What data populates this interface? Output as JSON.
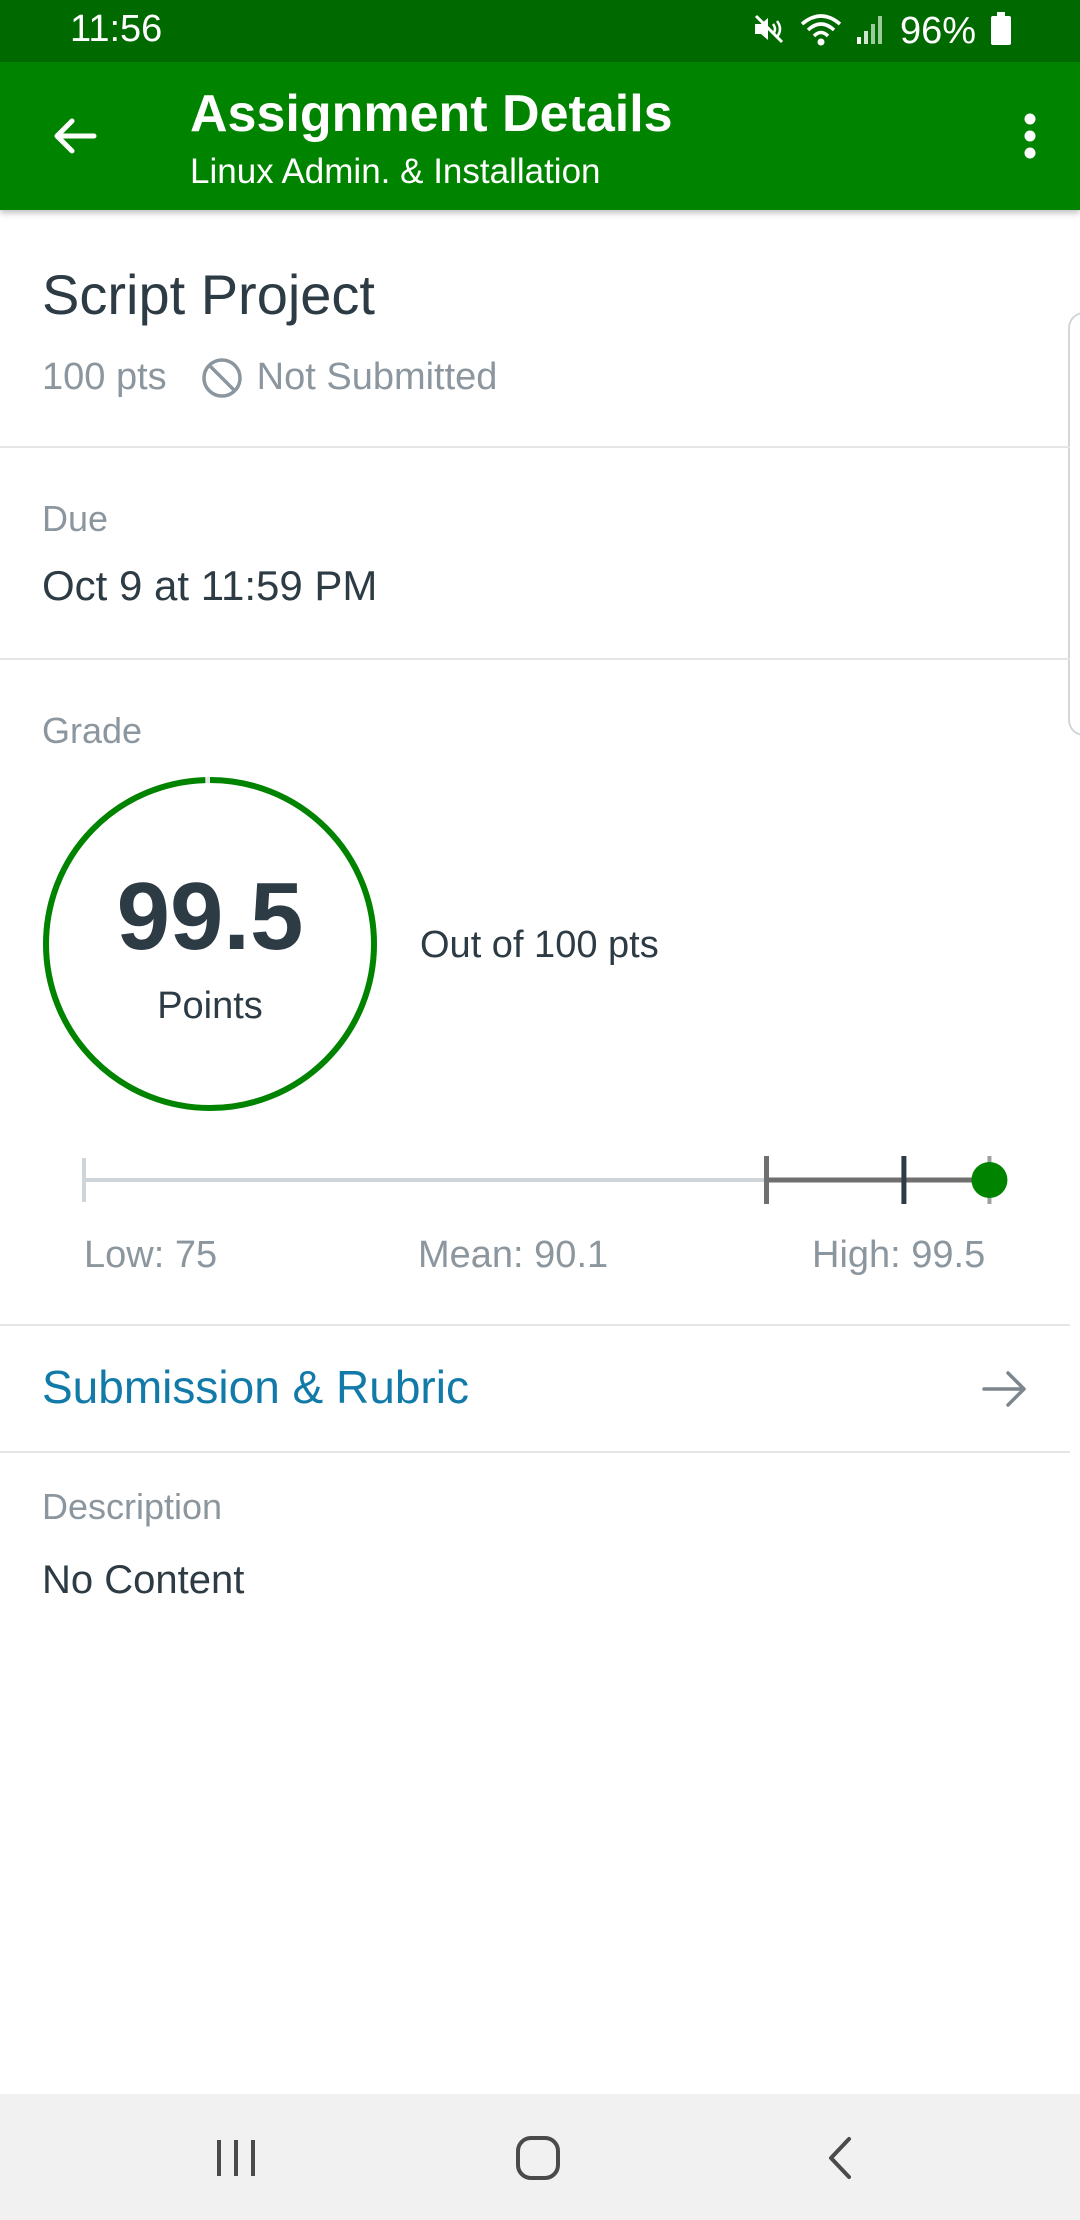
{
  "status_bar": {
    "time": "11:56",
    "battery_percent": "96%",
    "icons": [
      "mute-icon",
      "wifi-icon",
      "signal-icon",
      "battery-icon"
    ]
  },
  "app_bar": {
    "title": "Assignment Details",
    "subtitle": "Linux Admin. & Installation",
    "icons": [
      "back-arrow-icon",
      "more-vert-icon"
    ]
  },
  "assignment": {
    "title": "Script Project",
    "points": "100 pts",
    "submission_status": "Not Submitted",
    "status_icon": "not-submitted-icon"
  },
  "due": {
    "label": "Due",
    "value": "Oct 9 at 11:59 PM"
  },
  "grade": {
    "label": "Grade",
    "score": "99.5",
    "unit": "Points",
    "out_of": "Out of 100 pts",
    "score_value": 99.5,
    "max_points": 100,
    "accent_color": "#008400"
  },
  "stats": {
    "low_label": "Low: 75",
    "mean_label": "Mean: 90.1",
    "high_label": "High: 99.5",
    "low": 75,
    "mean": 90.1,
    "high": 99.5,
    "score": 99.5
  },
  "submission_link": {
    "label": "Submission & Rubric",
    "color": "#127aa8",
    "icon": "arrow-right-icon"
  },
  "description": {
    "label": "Description",
    "value": "No Content"
  },
  "nav_bar": {
    "icons": [
      "recent-apps-icon",
      "home-icon",
      "back-icon"
    ]
  }
}
